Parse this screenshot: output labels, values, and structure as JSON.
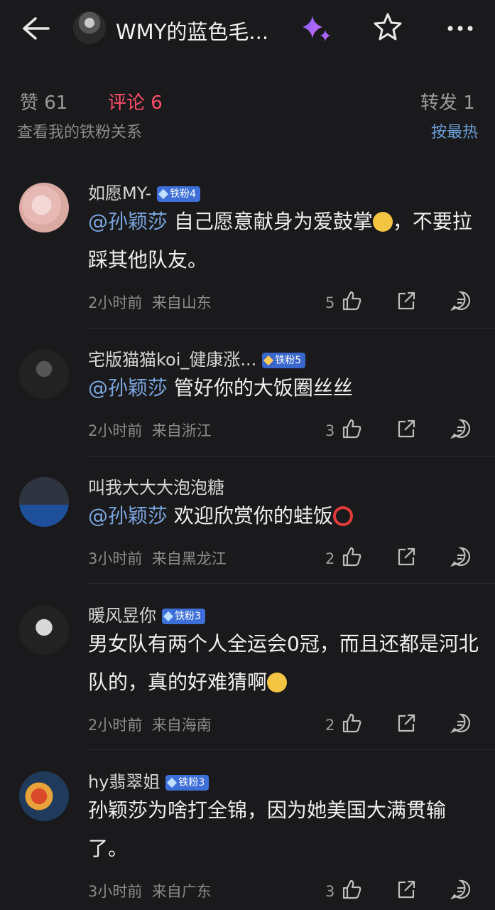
{
  "header": {
    "title": "WMY的蓝色毛...",
    "icons": [
      "back-arrow-icon",
      "avatar",
      "sparkle-icon",
      "star-icon",
      "more-icon"
    ]
  },
  "tabs": [
    {
      "label": "赞 61"
    },
    {
      "label": "评论 6"
    },
    {
      "label": "转发 1"
    }
  ],
  "clipped_row": {
    "left": "查看我的铁粉关系",
    "right": "按最热"
  },
  "comments": [
    {
      "user": "如愿MY-",
      "badge": "铁粉4",
      "mention": "@孙颖莎",
      "text": " 自己愿意献身为爱鼓掌",
      "text2": "，不要拉踩其他队友。",
      "emoji": "clap",
      "time": "2小时前",
      "location": "来自山东",
      "likes": "5"
    },
    {
      "user": "宅版猫猫koi_健康涨...",
      "badge": "铁粉5",
      "mention": "@孙颖莎",
      "text": " 管好你的大饭圈丝丝",
      "time": "2小时前",
      "location": "来自浙江",
      "likes": "3"
    },
    {
      "user": "叫我大大大泡泡糖",
      "mention": "@孙颖莎",
      "text": " 欢迎欣赏你的蛙饭",
      "emoji": "circle",
      "time": "3小时前",
      "location": "来自黑龙江",
      "likes": "2"
    },
    {
      "user": "暖风昱你",
      "badge": "铁粉3",
      "text": "男女队有两个人全运会0冠，而且还都是河北队的，真的好难猜啊",
      "emoji": "smile",
      "time": "2小时前",
      "location": "来自海南",
      "likes": "2"
    },
    {
      "user": "hy翡翠姐",
      "badge": "铁粉3",
      "text": "孙颖莎为啥打全锦，因为她美国大满贯输了。",
      "time": "3小时前",
      "location": "来自广东",
      "likes": "3"
    }
  ],
  "colors": {
    "background": "#1a1a1c",
    "accent": "#ff4d6a",
    "mention": "#7aa6e0",
    "badge": "#3e6fd8"
  }
}
